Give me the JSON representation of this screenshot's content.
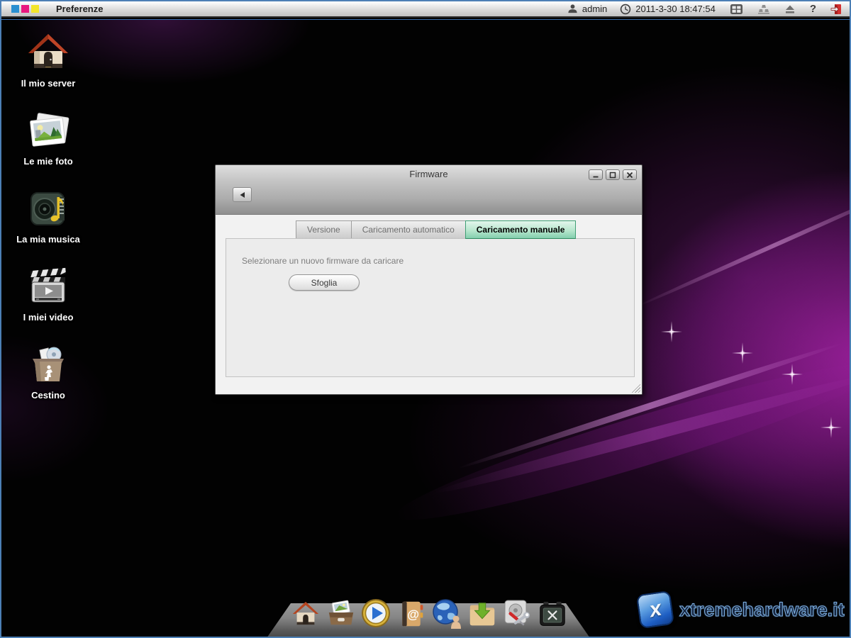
{
  "menubar": {
    "menu": "Preferenze",
    "user": "admin",
    "datetime": "2011-3-30 18:47:54",
    "help": "?"
  },
  "desktop": {
    "icons": [
      {
        "name": "server",
        "label": "Il mio server"
      },
      {
        "name": "photos",
        "label": "Le mie foto"
      },
      {
        "name": "music",
        "label": "La mia musica"
      },
      {
        "name": "videos",
        "label": "I miei video"
      },
      {
        "name": "trash",
        "label": "Cestino"
      }
    ]
  },
  "window": {
    "title": "Firmware",
    "tabs": [
      {
        "label": "Versione",
        "active": false
      },
      {
        "label": "Caricamento automatico",
        "active": false
      },
      {
        "label": "Caricamento manuale",
        "active": true
      }
    ],
    "content": {
      "instruction": "Selezionare un nuovo firmware da caricare",
      "browse_label": "Sfoglia"
    }
  },
  "dock": {
    "items": [
      "home",
      "photo-box",
      "media-player",
      "contacts",
      "web-globe",
      "download-folder",
      "disk-utilities",
      "toolbox"
    ]
  },
  "watermark": {
    "text": "xtremehardware.it",
    "badge_letter": "x"
  },
  "colors": {
    "active_tab_green": "#84cfae",
    "screen_border_blue": "#4c7fb5",
    "logout_red": "#cf2a2a",
    "logo_blue": "#2a8fd0",
    "logo_magenta": "#e8197f",
    "logo_yellow": "#f2e52b",
    "swirl_magenta": "#c42cc4"
  }
}
